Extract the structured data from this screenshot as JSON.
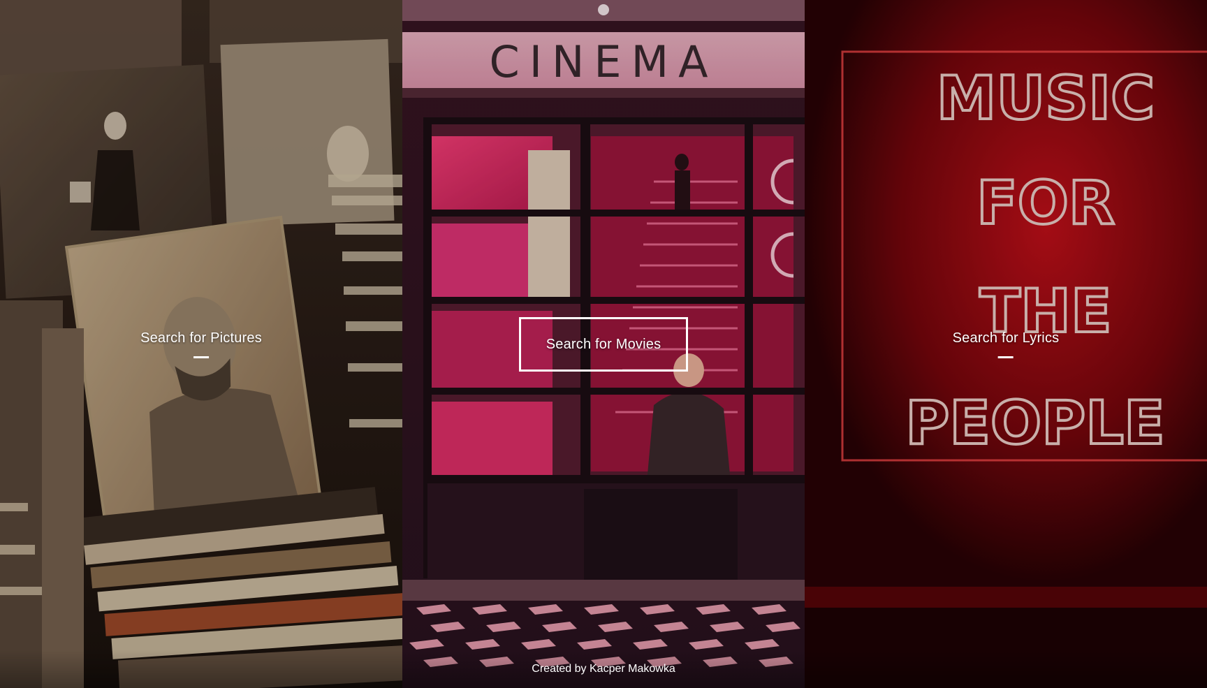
{
  "panels": {
    "pictures": {
      "label": "Search for Pictures"
    },
    "movies": {
      "label": "Search for Movies",
      "sign": "CINEMA"
    },
    "lyrics": {
      "label": "Search for Lyrics",
      "neon_lines": [
        "MUSIC",
        "FOR",
        "THE",
        "PEOPLE"
      ]
    }
  },
  "footer": {
    "credit": "Created by Kacper Makowka"
  },
  "colors": {
    "pictures_tint": "#3a2a1e",
    "movies_tint": "#d8305f",
    "lyrics_tint": "#b00c14",
    "text": "#ffffff"
  }
}
